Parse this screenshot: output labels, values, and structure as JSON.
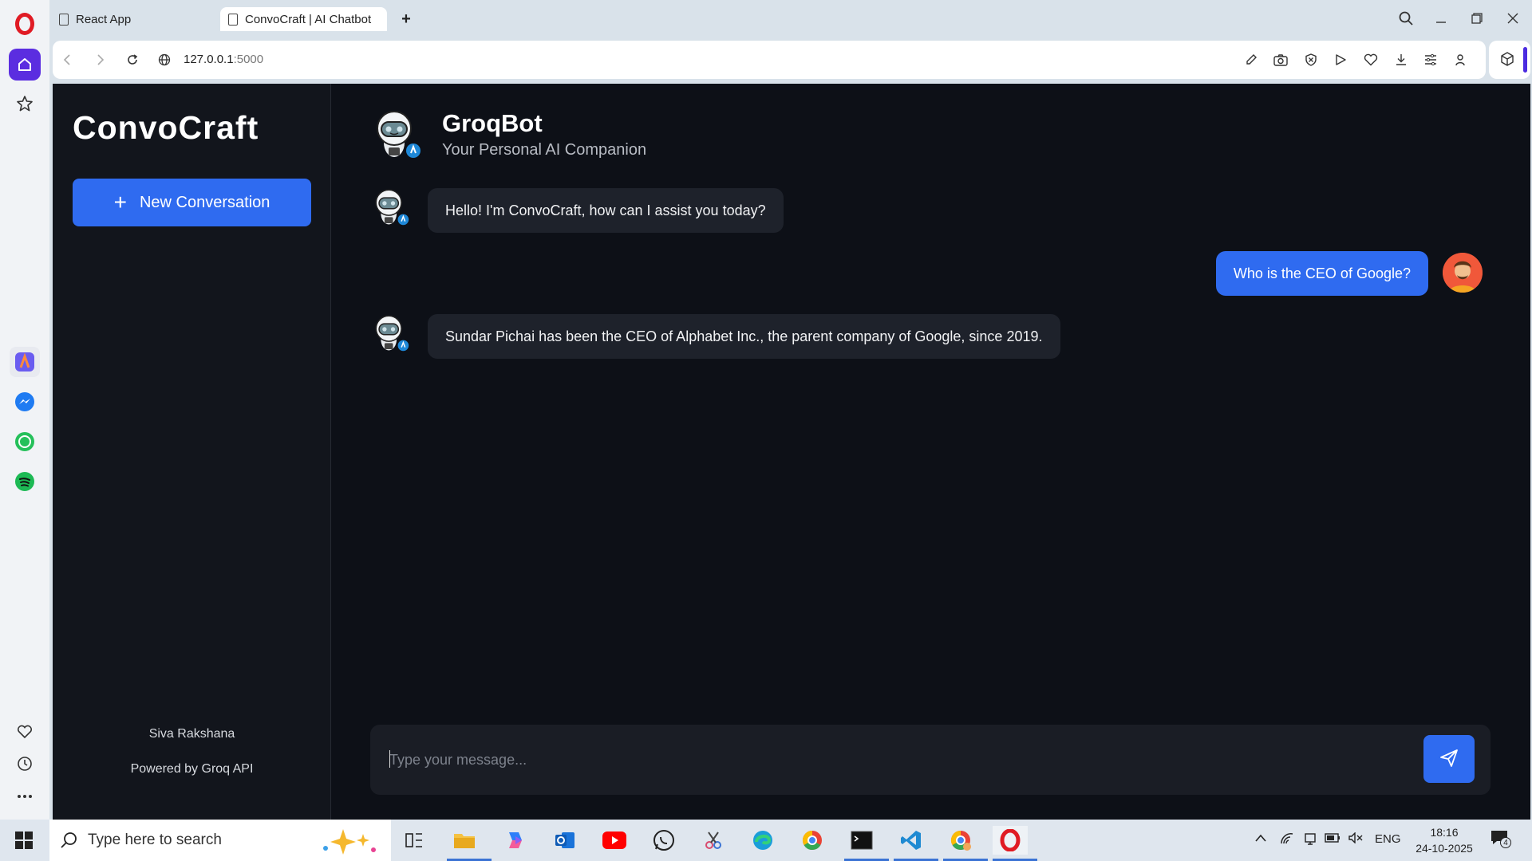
{
  "browser": {
    "tabs": [
      {
        "title": "React App"
      },
      {
        "title": "ConvoCraft | AI Chatbot"
      }
    ],
    "url": "127.0.0.1",
    "url_port": ":5000"
  },
  "sidebar": {
    "brand": "ConvoCraft",
    "new_conversation_label": "New Conversation",
    "author": "Siva Rakshana",
    "powered_by": "Powered by Groq API"
  },
  "header": {
    "bot_name": "GroqBot",
    "bot_tagline": "Your Personal AI Companion"
  },
  "messages": [
    {
      "role": "bot",
      "text": "Hello! I'm ConvoCraft, how can I assist you today?"
    },
    {
      "role": "user",
      "text": "Who is the CEO of Google?"
    },
    {
      "role": "bot",
      "text": "Sundar Pichai has been the CEO of Alphabet Inc., the parent company of Google, since 2019."
    }
  ],
  "composer": {
    "placeholder": "Type your message..."
  },
  "taskbar": {
    "search_placeholder": "Type here to search",
    "language": "ENG",
    "time": "18:16",
    "date": "24-10-2025",
    "notification_count": "4"
  },
  "colors": {
    "accent": "#2f6bf0",
    "app_bg": "#0d1017",
    "sidebar_bg": "#12151c",
    "bot_bubble": "#1e222b",
    "opera_red": "#e01b24"
  }
}
